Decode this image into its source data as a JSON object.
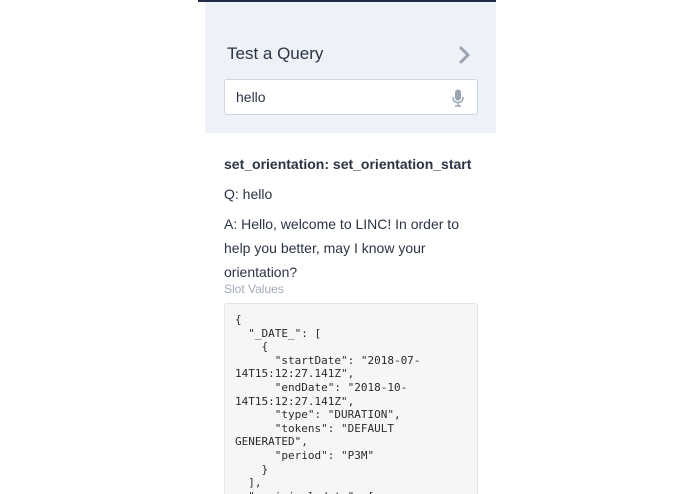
{
  "query_panel": {
    "title": "Test a Query",
    "input_value": "hello",
    "chevron_icon": "chevron-right-icon",
    "mic_icon": "microphone-icon"
  },
  "result": {
    "intent": "set_orientation: set_orientation_start",
    "question": "Q: hello",
    "answer": "A: Hello, welcome to LINC! In order to help you better, may I know your orientation?"
  },
  "slot_values": {
    "label": "Slot Values",
    "code": "{\n  \"_DATE_\": [\n    {\n      \"startDate\": \"2018-07-\n14T15:12:27.141Z\",\n      \"endDate\": \"2018-10-\n14T15:12:27.141Z\",\n      \"type\": \"DURATION\",\n      \"tokens\": \"DEFAULT\nGENERATED\",\n      \"period\": \"P3M\"\n    }\n  ],\n  \"_original_date\": ["
  },
  "colors": {
    "header_background": "#eef1f8",
    "text": "#2b3445",
    "muted_label": "#a3abba",
    "top_border": "#1f2a44"
  }
}
